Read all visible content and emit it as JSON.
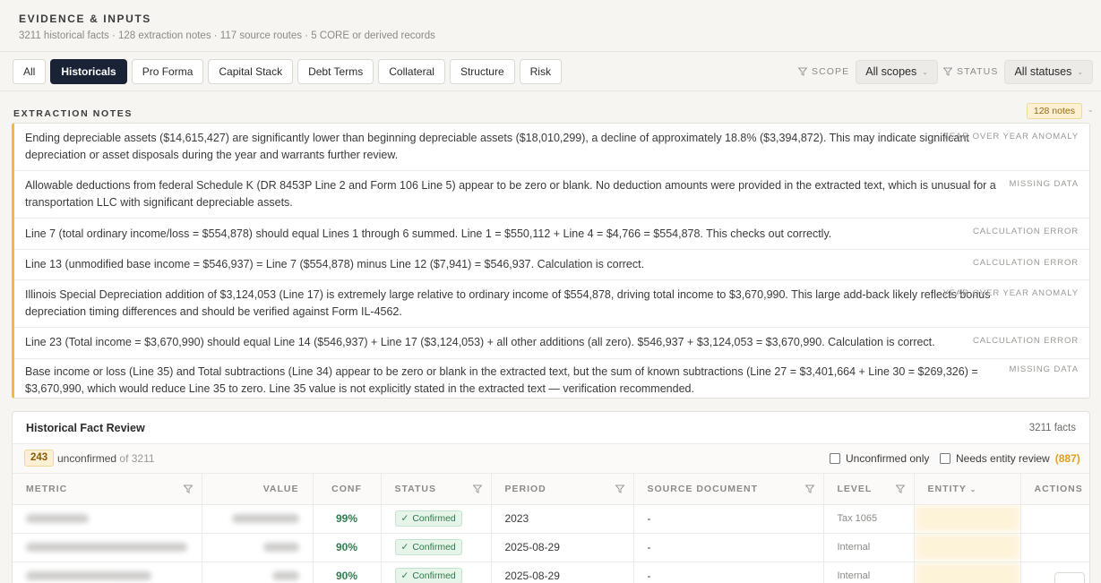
{
  "header": {
    "title": "EVIDENCE & INPUTS",
    "subtitle": "3211 historical facts · 128 extraction notes · 117 source routes · 5 CORE or derived records"
  },
  "tabs": [
    {
      "label": "All",
      "active": false
    },
    {
      "label": "Historicals",
      "active": true
    },
    {
      "label": "Pro Forma",
      "active": false
    },
    {
      "label": "Capital Stack",
      "active": false
    },
    {
      "label": "Debt Terms",
      "active": false
    },
    {
      "label": "Collateral",
      "active": false
    },
    {
      "label": "Structure",
      "active": false
    },
    {
      "label": "Risk",
      "active": false
    }
  ],
  "filters": {
    "scope_label": "SCOPE",
    "scope_value": "All scopes",
    "status_label": "STATUS",
    "status_value": "All statuses"
  },
  "extraction_notes": {
    "title": "EXTRACTION NOTES",
    "badge": "128 notes",
    "items": [
      {
        "text": "Ending depreciable assets ($14,615,427) are significantly lower than beginning depreciable assets ($18,010,299), a decline of approximately 18.8% ($3,394,872). This may indicate significant depreciation or asset disposals during the year and warrants further review.",
        "tag": "YEAR OVER YEAR ANOMALY"
      },
      {
        "text": "Allowable deductions from federal Schedule K (DR 8453P Line 2 and Form 106 Line 5) appear to be zero or blank. No deduction amounts were provided in the extracted text, which is unusual for a transportation LLC with significant depreciable assets.",
        "tag": "MISSING DATA"
      },
      {
        "text": "Line 7 (total ordinary income/loss = $554,878) should equal Lines 1 through 6 summed. Line 1 = $550,112 + Line 4 = $4,766 = $554,878. This checks out correctly.",
        "tag": "CALCULATION ERROR"
      },
      {
        "text": "Line 13 (unmodified base income = $546,937) = Line 7 ($554,878) minus Line 12 ($7,941) = $546,937. Calculation is correct.",
        "tag": "CALCULATION ERROR"
      },
      {
        "text": "Illinois Special Depreciation addition of $3,124,053 (Line 17) is extremely large relative to ordinary income of $554,878, driving total income to $3,670,990. This large add-back likely reflects bonus depreciation timing differences and should be verified against Form IL-4562.",
        "tag": "YEAR OVER YEAR ANOMALY"
      },
      {
        "text": "Line 23 (Total income = $3,670,990) should equal Line 14 ($546,937) + Line 17 ($3,124,053) + all other additions (all zero). $546,937 + $3,124,053 = $3,670,990. Calculation is correct.",
        "tag": "CALCULATION ERROR"
      },
      {
        "text": "Base income or loss (Line 35) and Total subtractions (Line 34) appear to be zero or blank in the extracted text, but the sum of known subtractions (Line 27 = $3,401,664 + Line 30 = $269,326) = $3,670,990, which would reduce Line 35 to zero. Line 35 value is not explicitly stated in the extracted text — verification recommended.",
        "tag": "MISSING DATA"
      }
    ]
  },
  "facts": {
    "title": "Historical Fact Review",
    "count": "3211 facts",
    "unconfirmed_count": "243",
    "unconfirmed_label": "unconfirmed",
    "unconfirmed_of": "of 3211",
    "unconfirmed_only_label": "Unconfirmed only",
    "needs_entity_label": "Needs entity review",
    "needs_entity_count": "(887)",
    "columns": [
      "METRIC",
      "VALUE",
      "CONF",
      "STATUS",
      "PERIOD",
      "SOURCE DOCUMENT",
      "LEVEL",
      "ENTITY",
      "ACTIONS"
    ],
    "rows": [
      {
        "conf": "99%",
        "status": "Confirmed",
        "period": "2023",
        "source": "-",
        "level": "Tax 1065"
      },
      {
        "conf": "90%",
        "status": "Confirmed",
        "period": "2025-08-29",
        "source": "-",
        "level": "Internal"
      },
      {
        "conf": "90%",
        "status": "Confirmed",
        "period": "2025-08-29",
        "source": "-",
        "level": "Internal"
      }
    ]
  }
}
